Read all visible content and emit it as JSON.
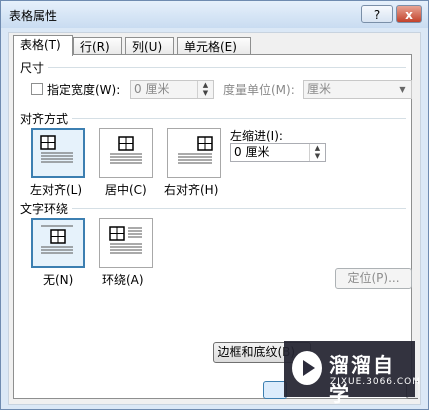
{
  "window": {
    "title": "表格属性",
    "help_label": "?",
    "close_label": "x"
  },
  "tabs": [
    {
      "label": "表格(T)"
    },
    {
      "label": "行(R)"
    },
    {
      "label": "列(U)"
    },
    {
      "label": "单元格(E)"
    }
  ],
  "size": {
    "heading": "尺寸",
    "specify_width_label": "指定宽度(W):",
    "width_value": "0 厘米",
    "unit_label": "度量单位(M):",
    "unit_value": "厘米"
  },
  "alignment": {
    "heading": "对齐方式",
    "options": [
      {
        "label": "左对齐(L)",
        "selected": true
      },
      {
        "label": "居中(C)",
        "selected": false
      },
      {
        "label": "右对齐(H)",
        "selected": false
      }
    ],
    "indent_label": "左缩进(I):",
    "indent_value": "0 厘米"
  },
  "wrapping": {
    "heading": "文字环绕",
    "options": [
      {
        "label": "无(N)",
        "selected": true
      },
      {
        "label": "环绕(A)",
        "selected": false
      }
    ],
    "position_button": "定位(P)..."
  },
  "footer": {
    "borders_button": "边框和底纹(B)..."
  },
  "watermark": {
    "name": "溜溜自学",
    "url": "ZIXUE.3066.COM"
  }
}
